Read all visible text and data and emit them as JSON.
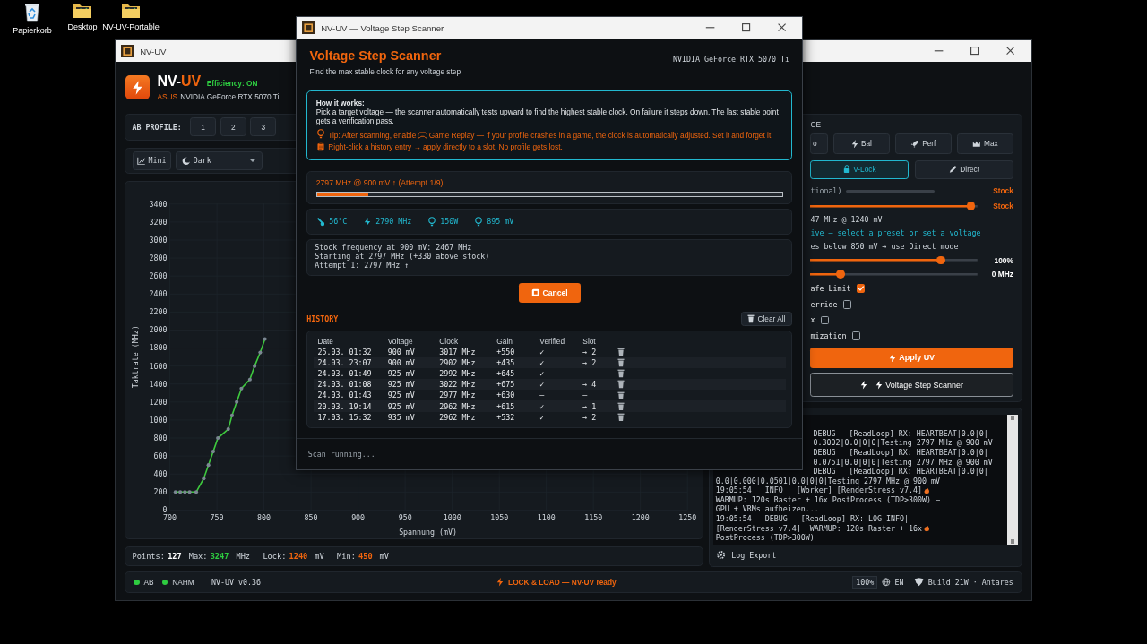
{
  "desktop_icons": [
    {
      "label": "Papierkorb",
      "kind": "trash"
    },
    {
      "label": "Desktop",
      "kind": "folder"
    },
    {
      "label": "NV-UV-Portable",
      "kind": "folder"
    }
  ],
  "main_window": {
    "title": "NV-UV",
    "brand": {
      "prefix": "NV-",
      "suffix": "UV",
      "efficiency": "Efficiency: ON",
      "vendor": "ASUS",
      "gpu": "NVIDIA GeForce RTX 5070 Ti"
    },
    "ab_profile": {
      "label": "AB PROFILE:",
      "slots": [
        "1",
        "2",
        "3"
      ]
    },
    "toolbar": {
      "mini": "Mini",
      "theme": "Dark"
    },
    "chart": {
      "chart_data": {
        "type": "line",
        "grid": true,
        "xlabel": "Spannung (mV)",
        "ylabel": "Taktrate (MHz)",
        "xlim": [
          700,
          1250
        ],
        "ylim": [
          0,
          3400
        ],
        "xticks": [
          700,
          750,
          800,
          850,
          900,
          950,
          1000,
          1050,
          1100,
          1150,
          1200,
          1250
        ],
        "yticks": [
          0,
          200,
          400,
          600,
          800,
          1000,
          1200,
          1400,
          1600,
          1800,
          2000,
          2200,
          2400,
          2600,
          2800,
          3000,
          3200,
          3400
        ],
        "x": [
          706,
          711,
          716,
          721,
          728,
          736,
          741,
          746,
          751,
          762,
          766,
          771,
          776,
          785,
          790,
          796,
          801
        ],
        "series": [
          {
            "color": "#3ec93e",
            "values": [
              200,
              200,
              200,
              200,
              200,
              350,
              500,
              650,
              800,
              900,
              1050,
              1200,
              1350,
              1450,
              1600,
              1750,
              1900
            ]
          }
        ]
      }
    },
    "stats": [
      {
        "label": "Points:",
        "value": "127",
        "color": "#ffffff"
      },
      {
        "label": "Max:",
        "value": "3247",
        "unit": "MHz",
        "color": "#2ecc40"
      },
      {
        "label": "Lock:",
        "value": "1240",
        "unit": "mV",
        "color": "#f0650e"
      },
      {
        "label": "Min:",
        "value": "450",
        "unit": "mV",
        "color": "#f0650e"
      }
    ],
    "status_bar": {
      "indicators": [
        {
          "label": "AB",
          "color": "#2ecc40"
        },
        {
          "label": "NAHM",
          "color": "#2ecc40"
        }
      ],
      "version": "NV-UV v0.36",
      "message": "LOCK & LOAD — NV-UV ready",
      "zoom": "100%",
      "language": "EN",
      "build": "Build 21W · Antares"
    },
    "side_panel": {
      "heading": "CE",
      "presets": [
        "o",
        "Bal",
        "Perf",
        "Max"
      ],
      "modes": [
        {
          "label": "V-Lock",
          "selected": true
        },
        {
          "label": "Direct",
          "selected": false
        }
      ],
      "optional_label": "tional)",
      "optional_value": "Stock",
      "sliders": [
        {
          "level": 0.96,
          "reading": "Stock"
        },
        {
          "level": 0.78,
          "reading": "100%"
        },
        {
          "level": 0.18,
          "reading": "0 MHz"
        }
      ],
      "info_lines": [
        {
          "text": "47 MHz @ 1240 mV",
          "kind": "plain"
        },
        {
          "text": "ive — select a preset or set a voltage",
          "kind": "hint"
        },
        {
          "text": "es below 850 mV → use Direct mode",
          "kind": "plain"
        }
      ],
      "checks": [
        {
          "label": "afe Limit",
          "checked": true
        },
        {
          "label": "erride",
          "checked": false
        },
        {
          "label": "x",
          "checked": false
        },
        {
          "label": "mization",
          "checked": false
        }
      ],
      "apply_button": "Apply UV",
      "scanner_button": "Voltage Step Scanner",
      "log_lines": [
        "DEBUG   [ReadLoop] RX: HEARTBEAT|0.0|0|",
        "0.3002|0.0|0|0|Testing 2797 MHz @ 900 mV",
        "DEBUG   [ReadLoop] RX: HEARTBEAT|0.0|0|",
        "0.0751|0.0|0|0|Testing 2797 MHz @ 900 mV",
        "DEBUG   [ReadLoop] RX: HEARTBEAT|0.0|0|",
        "0.0|0.000|0.0501|0.0|0|0|Testing 2797 MHz @ 900 mV",
        "19:05:54   INFO   [Worker] [RenderStress v7.4]",
        "WARMUP: 120s Raster + 16x PostProcess (TDP>300W) —",
        "GPU + VRMs aufheizen...",
        "19:05:54   DEBUG   [ReadLoop] RX: LOG|INFO|",
        "[RenderStress v7.4]  WARMUP: 120s Raster + 16x",
        "PostProcess (TDP>300W)"
      ],
      "log_export": "Log Export"
    }
  },
  "dialog": {
    "title": "NV-UV — Voltage Step Scanner",
    "heading": "Voltage Step Scanner",
    "subtitle": "Find the max stable clock for any voltage step",
    "gpu": "NVIDIA GeForce RTX 5070 Ti",
    "how_it_works": {
      "title": "How it works:",
      "text": "Pick a target voltage — the scanner automatically tests upward to find the highest stable clock. On failure it steps down. The last stable point gets a verification pass.",
      "tip_before": "Tip: After scanning, enable",
      "tip_after": "Game Replay — if your profile crashes in a game, the clock is automatically adjusted. Set it and forget it.",
      "note": "Right-click a history entry → apply directly to a slot. No profile gets lost."
    },
    "progress": {
      "text": "2797 MHz @ 900 mV ↑ (Attempt 1/9)",
      "level": 0.11
    },
    "telemetry": [
      "56°C",
      "2790 MHz",
      "150W",
      "895 mV"
    ],
    "log": [
      "Stock frequency at 900 mV: 2467 MHz",
      "Starting at 2797 MHz (+330 above stock)",
      "Attempt 1: 2797 MHz ↑"
    ],
    "cancel": "Cancel",
    "history_label": "HISTORY",
    "clear_all": "Clear All",
    "history": {
      "columns": [
        "Date",
        "Voltage",
        "Clock",
        "Gain",
        "Verified",
        "Slot"
      ],
      "rows": [
        [
          "25.03. 01:32",
          "900 mV",
          "3017 MHz",
          "+550",
          "✓",
          "→ 2"
        ],
        [
          "24.03. 23:07",
          "900 mV",
          "2902 MHz",
          "+435",
          "✓",
          "→ 2"
        ],
        [
          "24.03. 01:49",
          "925 mV",
          "2992 MHz",
          "+645",
          "✓",
          "—"
        ],
        [
          "24.03. 01:08",
          "925 mV",
          "3022 MHz",
          "+675",
          "✓",
          "→ 4"
        ],
        [
          "24.03. 01:43",
          "925 mV",
          "2977 MHz",
          "+630",
          "—",
          "—"
        ],
        [
          "20.03. 19:14",
          "925 mV",
          "2962 MHz",
          "+615",
          "✓",
          "→ 1"
        ],
        [
          "17.03. 15:32",
          "935 mV",
          "2962 MHz",
          "+532",
          "✓",
          "→ 2"
        ]
      ]
    },
    "status": "Scan running..."
  }
}
